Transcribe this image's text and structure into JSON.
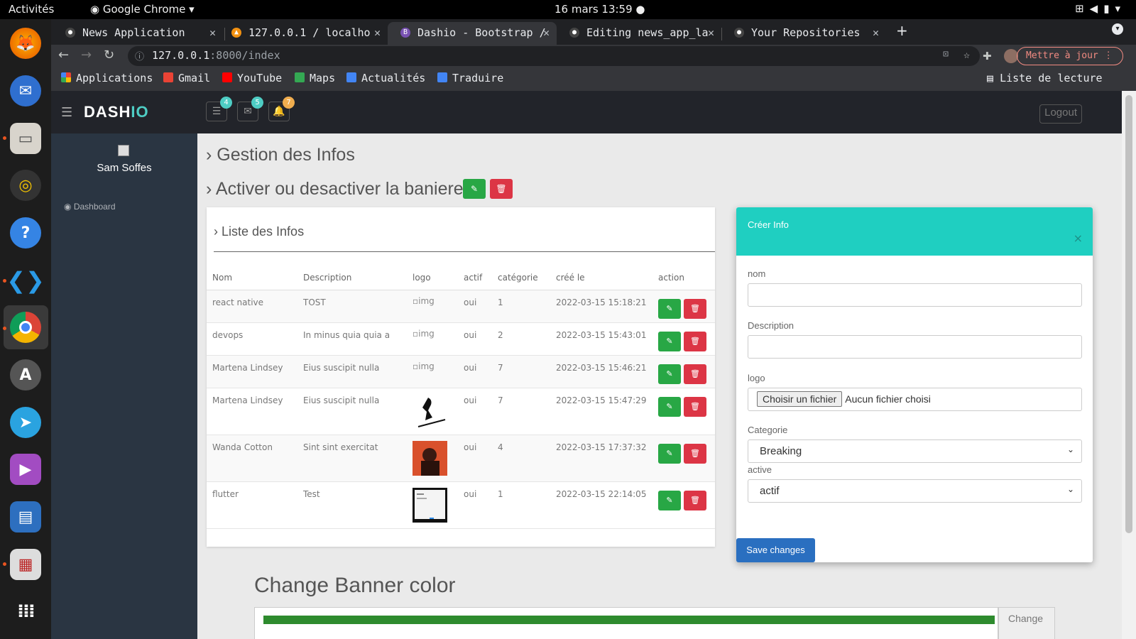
{
  "os": {
    "activities": "Activités",
    "app_name": "Google Chrome",
    "clock": "16 mars 13:59"
  },
  "browser": {
    "tabs": [
      {
        "label": "News Application"
      },
      {
        "label": "127.0.0.1 / localho"
      },
      {
        "label": "Dashio - Bootstrap /"
      },
      {
        "label": "Editing news_app_la"
      },
      {
        "label": "Your Repositories"
      }
    ],
    "url_host": "127.0.0.1",
    "url_rest": ":8000/index",
    "update_label": "Mettre à jour",
    "bookmarks": [
      "Applications",
      "Gmail",
      "YouTube",
      "Maps",
      "Actualités",
      "Traduire"
    ],
    "reading_list": "Liste de lecture"
  },
  "header": {
    "logo_main": "DASH",
    "logo_accent": "IO",
    "badges": [
      "4",
      "5",
      "7"
    ],
    "logout": "Logout"
  },
  "sidebar": {
    "user_name": "Sam Soffes",
    "nav_dashboard": "Dashboard"
  },
  "main": {
    "title_gestion": "Gestion des Infos",
    "title_baniere": "Activer ou desactiver la baniere",
    "list_title": "Liste des Infos",
    "columns": [
      "Nom",
      "Description",
      "logo",
      "actif",
      "catégorie",
      "créé le",
      "action"
    ],
    "rows": [
      {
        "nom": "react native",
        "description": "TOST",
        "logo": "img",
        "actif": "oui",
        "categorie": "1",
        "cree": "2022-03-15 15:18:21"
      },
      {
        "nom": "devops",
        "description": "In minus quia quia a",
        "logo": "img",
        "actif": "oui",
        "categorie": "2",
        "cree": "2022-03-15 15:43:01"
      },
      {
        "nom": "Martena Lindsey",
        "description": "Eius suscipit nulla",
        "logo": "img",
        "actif": "oui",
        "categorie": "7",
        "cree": "2022-03-15 15:46:21"
      },
      {
        "nom": "Martena Lindsey",
        "description": "Eius suscipit nulla",
        "logo": "",
        "actif": "oui",
        "categorie": "7",
        "cree": "2022-03-15 15:47:29"
      },
      {
        "nom": "Wanda Cotton",
        "description": "Sint sint exercitat",
        "logo": "",
        "actif": "oui",
        "categorie": "4",
        "cree": "2022-03-15 17:37:32"
      },
      {
        "nom": "flutter",
        "description": "Test",
        "logo": "",
        "actif": "oui",
        "categorie": "1",
        "cree": "2022-03-15 22:14:05"
      }
    ],
    "banner_title": "Change Banner color",
    "banner_change": "Change",
    "banner_color": "#2e8b2e"
  },
  "modal": {
    "title": "Créer Info",
    "close": "×",
    "label_nom": "nom",
    "label_description": "Description",
    "label_logo": "logo",
    "file_button": "Choisir un fichier",
    "file_status": "Aucun fichier choisi",
    "label_categorie": "Categorie",
    "categorie_value": "Breaking",
    "label_active": "active",
    "active_value": "actif",
    "save": "Save changes"
  },
  "colors": {
    "accent": "#4ecdc4",
    "modal_header": "#1fcfc1",
    "save": "#2a6fc0",
    "edit": "#28a745",
    "delete": "#dc3545"
  }
}
